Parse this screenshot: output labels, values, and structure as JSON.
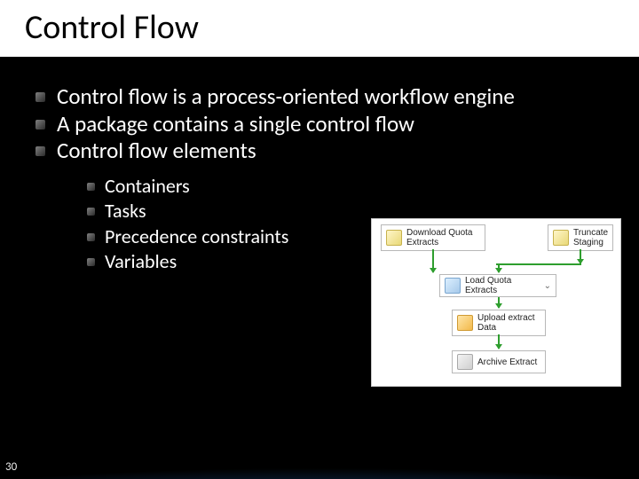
{
  "title": "Control Flow",
  "bullets": {
    "b1": "Control flow is a process-oriented workflow engine",
    "b2": "A package contains a single control flow",
    "b3": "Control flow elements",
    "sub": {
      "s1": "Containers",
      "s2": "Tasks",
      "s3": "Precedence constraints",
      "s4": "Variables"
    }
  },
  "diagram": {
    "download": "Download Quota Extracts",
    "truncate": "Truncate Staging",
    "loop": "Load Quota Extracts",
    "upload": "Upload extract Data",
    "archive": "Archive Extract"
  },
  "page_number": "30"
}
